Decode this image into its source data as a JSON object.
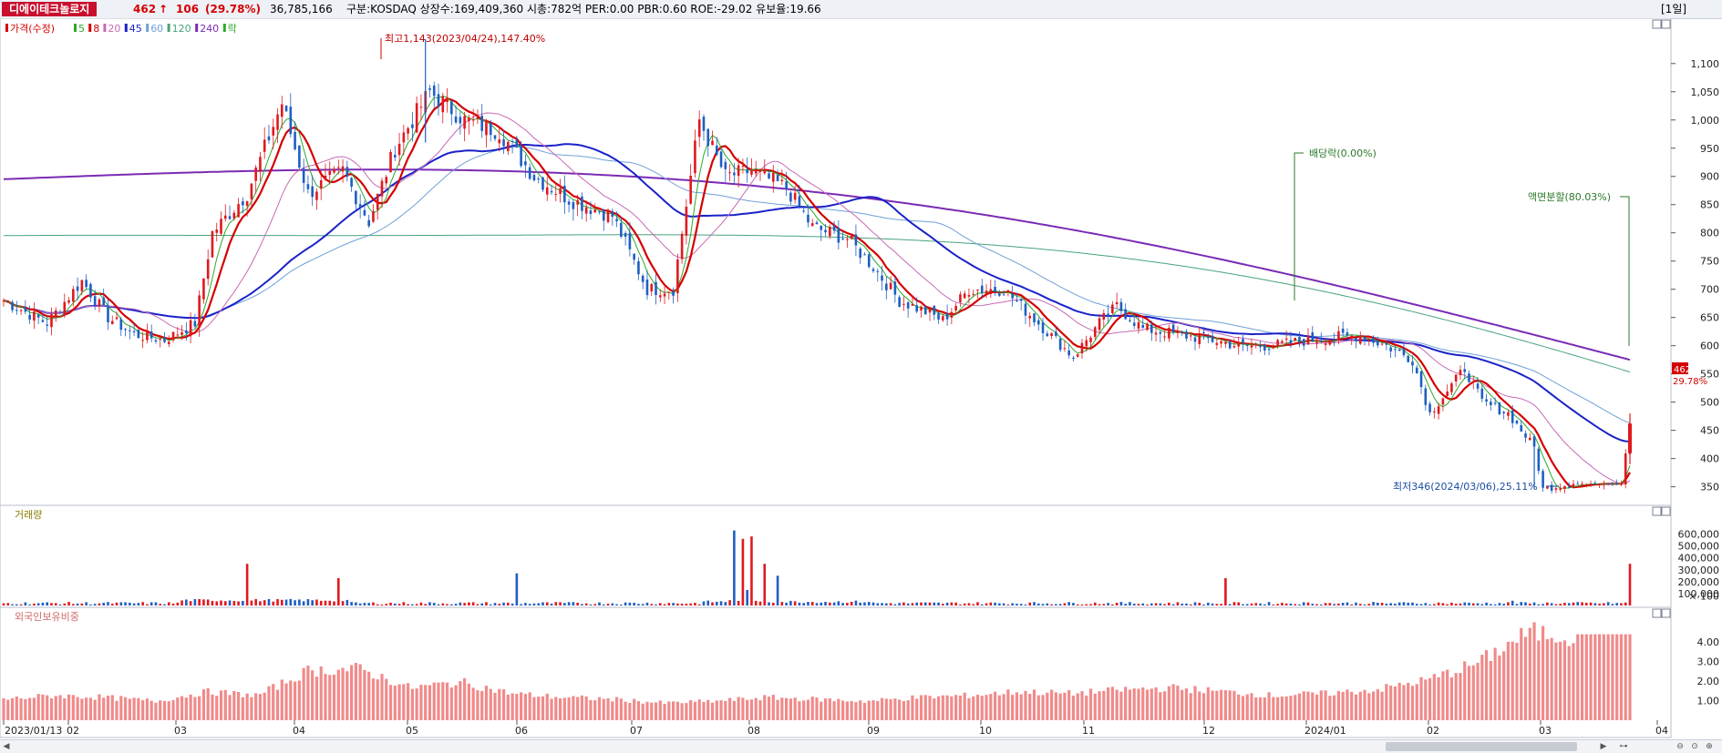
{
  "header": {
    "stock_name": "디에이테크놀로지",
    "price": "462",
    "change_arrow": "↑",
    "change": "106",
    "change_pct": "(29.78%)",
    "volume": "36,785,166",
    "info": "구분:KOSDAQ  상장수:169,409,360  시총:782억  PER:0.00  PBR:0.60  ROE:-29.02  유보율:19.66",
    "period": "[1일]"
  },
  "colors": {
    "up": "#e0191e",
    "down": "#1e5fc2",
    "ma5": "#2ea82e",
    "ma8": "#d40000",
    "ma20": "#c86ab4",
    "ma45": "#1a22c8",
    "ma60": "#6fa0d8",
    "ma120": "#49a37a",
    "ma240": "#7a2bb4"
  },
  "legend": [
    {
      "text": "가격(수정)",
      "color": "#d40000"
    },
    {
      "text": "5",
      "color": "#2ea82e"
    },
    {
      "text": "8",
      "color": "#d40000"
    },
    {
      "text": "20",
      "color": "#c86ab4"
    },
    {
      "text": "45",
      "color": "#1a22c8"
    },
    {
      "text": "60",
      "color": "#6fa0d8"
    },
    {
      "text": "120",
      "color": "#49a37a"
    },
    {
      "text": "240",
      "color": "#7a2bb4"
    },
    {
      "text": "락",
      "color": "#2ea82e"
    }
  ],
  "annotations": {
    "high": "최고1,143(2023/04/24),147.40%",
    "low": "최저346(2024/03/06),25.11%",
    "dividend": "배당락(0.00%)",
    "split": "액면분할(80.03%)",
    "last_price": "462",
    "last_pct": "29.78%"
  },
  "panels": {
    "volume_title": "거래량",
    "foreign_title": "외국인보유비중"
  },
  "x_labels": [
    "2023/01/13",
    "02",
    "03",
    "04",
    "05",
    "06",
    "07",
    "08",
    "09",
    "10",
    "11",
    "12",
    "2024/01",
    "02",
    "03",
    "04"
  ],
  "chart_data": [
    {
      "type": "candlestick",
      "title": "",
      "ylim": [
        330,
        1140
      ],
      "y_ticks": [
        "1,100",
        "1,050",
        "1,000",
        "950",
        "900",
        "850",
        "800",
        "750",
        "700",
        "650",
        "600",
        "550",
        "500",
        "450",
        "400",
        "350"
      ],
      "close_path": [
        [
          0,
          680
        ],
        [
          10,
          640
        ],
        [
          18,
          715
        ],
        [
          24,
          650
        ],
        [
          30,
          620
        ],
        [
          37,
          610
        ],
        [
          44,
          640
        ],
        [
          48,
          800
        ],
        [
          56,
          870
        ],
        [
          64,
          1030
        ],
        [
          70,
          870
        ],
        [
          78,
          910
        ],
        [
          84,
          820
        ],
        [
          90,
          950
        ],
        [
          98,
          1050
        ],
        [
          106,
          1000
        ],
        [
          114,
          980
        ],
        [
          122,
          900
        ],
        [
          130,
          860
        ],
        [
          140,
          830
        ],
        [
          148,
          700
        ],
        [
          154,
          700
        ],
        [
          160,
          1000
        ],
        [
          166,
          900
        ],
        [
          172,
          910
        ],
        [
          180,
          880
        ],
        [
          186,
          810
        ],
        [
          194,
          790
        ],
        [
          200,
          740
        ],
        [
          206,
          680
        ],
        [
          212,
          660
        ],
        [
          216,
          645
        ],
        [
          222,
          700
        ],
        [
          230,
          700
        ],
        [
          238,
          640
        ],
        [
          246,
          580
        ],
        [
          252,
          640
        ],
        [
          256,
          670
        ],
        [
          262,
          630
        ],
        [
          270,
          620
        ],
        [
          278,
          610
        ],
        [
          284,
          600
        ],
        [
          292,
          600
        ],
        [
          300,
          610
        ],
        [
          306,
          615
        ],
        [
          312,
          618
        ],
        [
          318,
          600
        ],
        [
          324,
          575
        ],
        [
          328,
          480
        ],
        [
          332,
          520
        ],
        [
          336,
          560
        ],
        [
          340,
          500
        ],
        [
          346,
          480
        ],
        [
          352,
          420
        ],
        [
          354,
          346
        ],
        [
          360,
          355
        ],
        [
          366,
          355
        ],
        [
          372,
          356
        ],
        [
          374,
          462
        ]
      ],
      "x_ticks": [
        "2023/01/13",
        "02",
        "03",
        "04",
        "05",
        "06",
        "07",
        "08",
        "09",
        "10",
        "11",
        "12",
        "2024/01",
        "02",
        "03",
        "04"
      ],
      "high": {
        "value": 1143,
        "date": "2023/04/24",
        "pct": "147.40%"
      },
      "low": {
        "value": 346,
        "date": "2024/03/06",
        "pct": "25.11%"
      },
      "last": 462
    },
    {
      "type": "bar",
      "title": "거래량",
      "y_ticks": [
        "600,000",
        "500,000",
        "400,000",
        "300,000",
        "200,000",
        "100,000",
        "× 100"
      ],
      "values_x100": [
        180000,
        350000,
        630000,
        580000,
        530000,
        340000,
        220000,
        90000
      ]
    },
    {
      "type": "bar",
      "title": "외국인보유비중",
      "ylim": [
        0,
        4.8
      ],
      "y_ticks": [
        "4.00",
        "3.00",
        "2.00",
        "1.00"
      ],
      "values": [
        1.1,
        1.3,
        1.2,
        1.0,
        1.5,
        1.3,
        2.6,
        2.7,
        1.7,
        2.0,
        1.4,
        1.2,
        1.1,
        0.9,
        1.0,
        1.2,
        1.1,
        1.0,
        1.2,
        1.3,
        1.5,
        1.4,
        1.6,
        1.7,
        1.5,
        1.3,
        1.4,
        1.6,
        2.1,
        3.0,
        4.6,
        4.4,
        4.4
      ]
    }
  ]
}
